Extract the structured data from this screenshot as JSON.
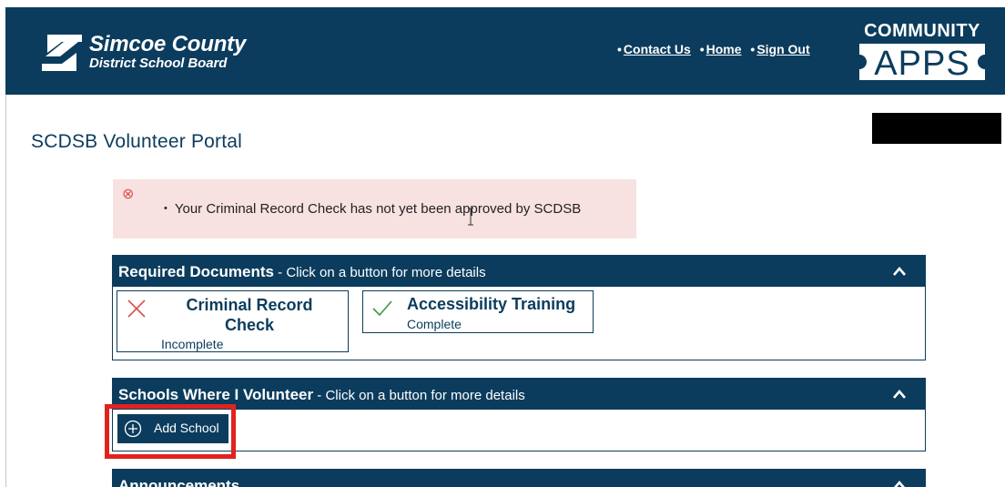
{
  "header": {
    "brand": {
      "line1": "Simcoe County",
      "line2": "District School Board"
    },
    "nav": [
      {
        "label": "Contact Us"
      },
      {
        "label": "Home"
      },
      {
        "label": "Sign Out"
      }
    ],
    "apps_logo": {
      "top": "COMMUNITY",
      "bottom": "APPS"
    }
  },
  "page": {
    "title": "SCDSB Volunteer Portal"
  },
  "alert": {
    "message": "Your Criminal Record Check has not yet been approved by SCDSB"
  },
  "panels": {
    "required_documents": {
      "title": "Required Documents",
      "subtitle": " - Click on a button for more details",
      "items": [
        {
          "name": "Criminal Record Check",
          "status": "Incomplete"
        },
        {
          "name": "Accessibility Training",
          "status": "Complete"
        }
      ]
    },
    "schools": {
      "title": "Schools Where I Volunteer",
      "subtitle": " - Click on a button for more details",
      "add_button": "Add School"
    },
    "announcements": {
      "title": "Announcements"
    }
  },
  "icons": {
    "error": "error-circle-icon",
    "incomplete": "x-mark-icon",
    "complete": "check-mark-icon",
    "collapse": "chevron-up-icon",
    "add": "plus-circle-icon"
  },
  "colors": {
    "brand_navy": "#0b3c5d",
    "alert_bg": "#f8e1e1",
    "error_red": "#d9534f",
    "highlight_red": "#e0231e",
    "check_green": "#3a9a3a"
  }
}
